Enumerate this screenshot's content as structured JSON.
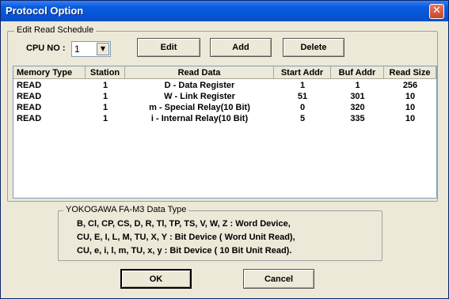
{
  "window": {
    "title": "Protocol Option",
    "close_glyph": "✕"
  },
  "schedule": {
    "legend": "Edit Read Schedule",
    "cpu_label": "CPU NO :",
    "cpu_value": "1",
    "buttons": {
      "edit": "Edit",
      "add": "Add",
      "delete": "Delete"
    }
  },
  "table": {
    "headers": [
      "Memory Type",
      "Station",
      "Read Data",
      "Start Addr",
      "Buf Addr",
      "Read Size"
    ],
    "rows": [
      [
        "READ",
        "1",
        "D - Data Register",
        "1",
        "1",
        "256"
      ],
      [
        "READ",
        "1",
        "W - Link Register",
        "51",
        "301",
        "10"
      ],
      [
        "READ",
        "1",
        "m - Special Relay(10 Bit)",
        "0",
        "320",
        "10"
      ],
      [
        "READ",
        "1",
        "i - Internal Relay(10 Bit)",
        "5",
        "335",
        "10"
      ]
    ]
  },
  "datatype": {
    "legend": "YOKOGAWA FA-M3 Data Type",
    "lines": [
      "B, Cl, CP, CS, D, R, Tl, TP, TS, V, W, Z : Word Device,",
      "CU, E, I, L, M, TU, X, Y : Bit Device ( Word Unit Read),",
      "CU, e, i, l, m, TU, x, y : Bit Device ( 10 Bit Unit Read)."
    ]
  },
  "dialog_buttons": {
    "ok": "OK",
    "cancel": "Cancel"
  }
}
